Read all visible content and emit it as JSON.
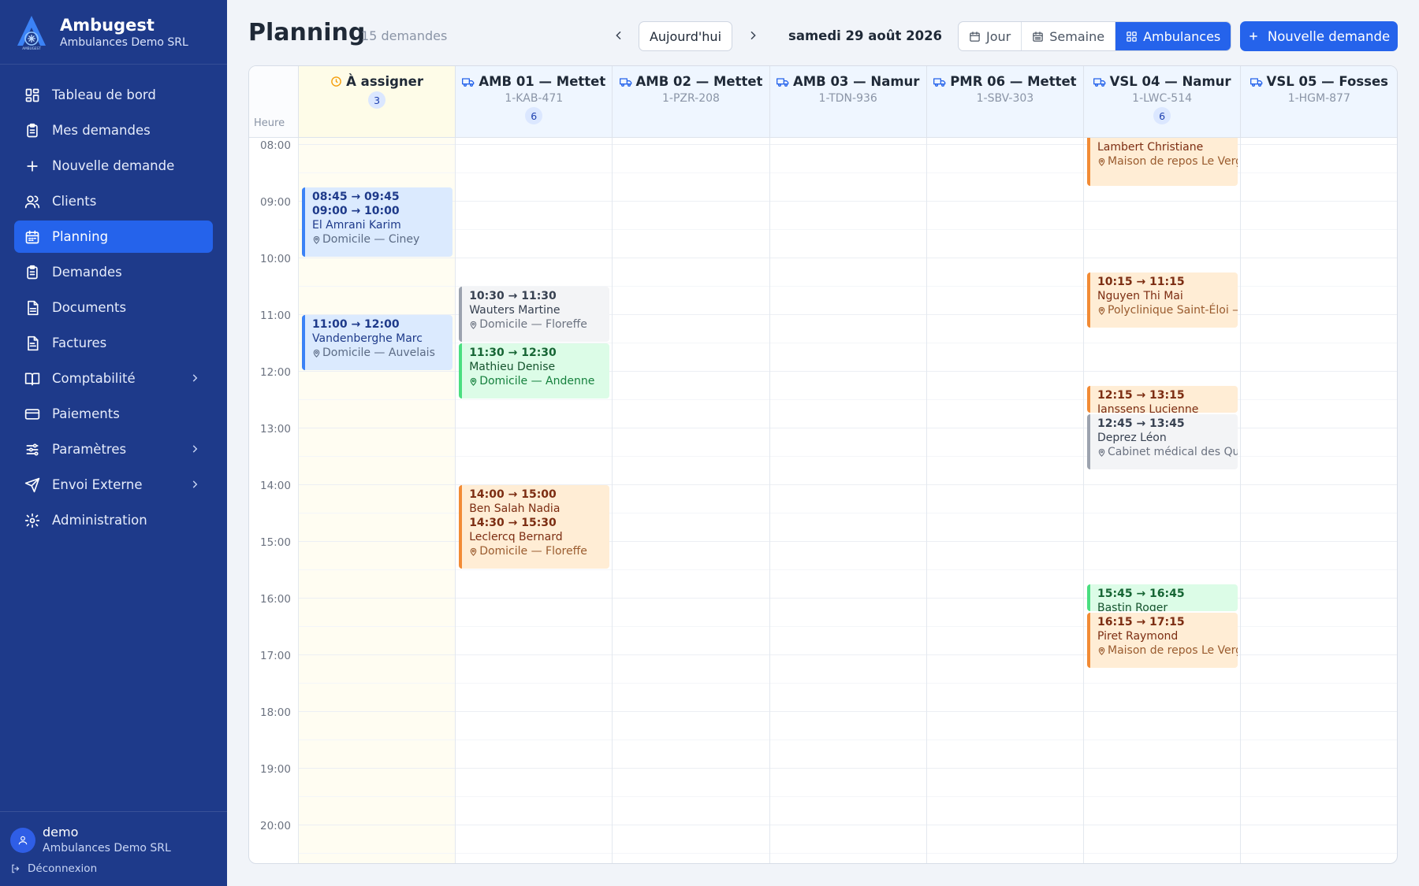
{
  "brand": {
    "name": "Ambugest",
    "org": "Ambulances Demo SRL",
    "logo_text": "AMBUGEST"
  },
  "colors": {
    "sidebar": "#1e3a8a",
    "accent": "#2563eb",
    "unassigned_bg": "#fffdf2"
  },
  "nav": [
    {
      "label": "Tableau de bord",
      "icon": "dashboard-icon"
    },
    {
      "label": "Mes demandes",
      "icon": "clipboard-icon"
    },
    {
      "label": "Nouvelle demande",
      "icon": "plus-icon"
    },
    {
      "label": "Clients",
      "icon": "users-icon"
    },
    {
      "label": "Planning",
      "icon": "calendar-icon",
      "active": true
    },
    {
      "label": "Demandes",
      "icon": "clipboard-icon"
    },
    {
      "label": "Documents",
      "icon": "document-icon"
    },
    {
      "label": "Factures",
      "icon": "invoice-icon"
    },
    {
      "label": "Comptabilité",
      "icon": "book-icon",
      "has_submenu": true
    },
    {
      "label": "Paiements",
      "icon": "credit-card-icon"
    },
    {
      "label": "Paramètres",
      "icon": "sliders-icon",
      "has_submenu": true
    },
    {
      "label": "Envoi Externe",
      "icon": "send-icon",
      "has_submenu": true
    },
    {
      "label": "Administration",
      "icon": "gear-icon"
    }
  ],
  "user": {
    "name": "demo",
    "org": "Ambulances Demo SRL",
    "logout_label": "Déconnexion"
  },
  "header": {
    "title": "Planning",
    "subtitle": "15 demandes",
    "today_label": "Aujourd'hui",
    "date_label": "samedi 29 août 2026",
    "views": [
      {
        "label": "Jour",
        "icon": "calendar-day-icon"
      },
      {
        "label": "Semaine",
        "icon": "calendar-week-icon"
      },
      {
        "label": "Ambulances",
        "icon": "grid-icon",
        "active": true
      }
    ],
    "new_label": "Nouvelle demande"
  },
  "grid": {
    "hour_header": "Heure",
    "hours": [
      "08:00",
      "09:00",
      "10:00",
      "11:00",
      "12:00",
      "13:00",
      "14:00",
      "15:00",
      "16:00",
      "17:00",
      "18:00",
      "19:00",
      "20:00"
    ],
    "columns": [
      {
        "title": "À assigner",
        "plate": "",
        "badge": "3",
        "type": "assign",
        "events": [
          {
            "color": "blue",
            "start": 8.75,
            "end": 10,
            "lines": [
              {
                "kind": "time",
                "text": "08:45 → 09:45"
              },
              {
                "kind": "time",
                "text": "09:00 → 10:00"
              },
              {
                "kind": "name",
                "text": "El Amrani Karim"
              },
              {
                "kind": "loc",
                "text": "Domicile — Ciney"
              }
            ]
          },
          {
            "color": "blue",
            "start": 11,
            "end": 12,
            "lines": [
              {
                "kind": "time",
                "text": "11:00 → 12:00"
              },
              {
                "kind": "name",
                "text": "Vandenberghe Marc"
              },
              {
                "kind": "loc",
                "text": "Domicile — Auvelais"
              }
            ]
          }
        ]
      },
      {
        "title": "AMB 01 — Mettet",
        "plate": "1-KAB-471",
        "badge": "6",
        "type": "vehicle",
        "events": [
          {
            "color": "gray",
            "start": 10.5,
            "end": 11.5,
            "lines": [
              {
                "kind": "time",
                "text": "10:30 → 11:30"
              },
              {
                "kind": "name",
                "text": "Wauters Martine"
              },
              {
                "kind": "loc",
                "text": "Domicile — Floreffe"
              }
            ]
          },
          {
            "color": "green",
            "start": 11.5,
            "end": 12.5,
            "lines": [
              {
                "kind": "time",
                "text": "11:30 → 12:30"
              },
              {
                "kind": "name",
                "text": "Mathieu Denise"
              },
              {
                "kind": "loc",
                "text": "Domicile — Andenne"
              }
            ]
          },
          {
            "color": "orange",
            "start": 14,
            "end": 15.5,
            "lines": [
              {
                "kind": "time",
                "text": "14:00 → 15:00"
              },
              {
                "kind": "name",
                "text": "Ben Salah Nadia"
              },
              {
                "kind": "time",
                "text": "14:30 → 15:30"
              },
              {
                "kind": "name",
                "text": "Leclercq Bernard"
              },
              {
                "kind": "loc",
                "text": "Domicile — Floreffe"
              }
            ]
          }
        ]
      },
      {
        "title": "AMB 02 — Mettet",
        "plate": "1-PZR-208",
        "badge": "",
        "type": "vehicle",
        "events": []
      },
      {
        "title": "AMB 03 — Namur",
        "plate": "1-TDN-936",
        "badge": "",
        "type": "vehicle",
        "events": []
      },
      {
        "title": "PMR 06 — Mettet",
        "plate": "1-SBV-303",
        "badge": "",
        "type": "vehicle",
        "events": []
      },
      {
        "title": "VSL 04 — Namur",
        "plate": "1-LWC-514",
        "badge": "6",
        "type": "vehicle",
        "events": [
          {
            "color": "orange",
            "start": 8,
            "end": 8.75,
            "lines": [
              {
                "kind": "name",
                "text": "Lambert Christiane"
              },
              {
                "kind": "loc",
                "text": "Maison de repos Le Verger"
              }
            ]
          },
          {
            "color": "orange",
            "start": 10.25,
            "end": 11.25,
            "lines": [
              {
                "kind": "time",
                "text": "10:15 → 11:15"
              },
              {
                "kind": "name",
                "text": "Nguyen Thi Mai"
              },
              {
                "kind": "loc",
                "text": "Polyclinique Saint-Éloi — Namur"
              }
            ]
          },
          {
            "color": "orange",
            "start": 12.25,
            "end": 12.75,
            "lines": [
              {
                "kind": "time",
                "text": "12:15 → 13:15"
              },
              {
                "kind": "name",
                "text": "Janssens Lucienne"
              }
            ]
          },
          {
            "color": "gray",
            "start": 12.75,
            "end": 13.75,
            "lines": [
              {
                "kind": "time",
                "text": "12:45 → 13:45"
              },
              {
                "kind": "name",
                "text": "Deprez Léon"
              },
              {
                "kind": "loc",
                "text": "Cabinet médical des Quatre"
              }
            ]
          },
          {
            "color": "green",
            "start": 15.75,
            "end": 16.25,
            "lines": [
              {
                "kind": "time",
                "text": "15:45 → 16:45"
              },
              {
                "kind": "name",
                "text": "Bastin Roger"
              }
            ]
          },
          {
            "color": "orange",
            "start": 16.25,
            "end": 17.25,
            "lines": [
              {
                "kind": "time",
                "text": "16:15 → 17:15"
              },
              {
                "kind": "name",
                "text": "Piret Raymond"
              },
              {
                "kind": "loc",
                "text": "Maison de repos Le Verger"
              }
            ]
          }
        ]
      },
      {
        "title": "VSL 05 — Fosses",
        "plate": "1-HGM-877",
        "badge": "",
        "type": "vehicle",
        "events": []
      }
    ]
  }
}
